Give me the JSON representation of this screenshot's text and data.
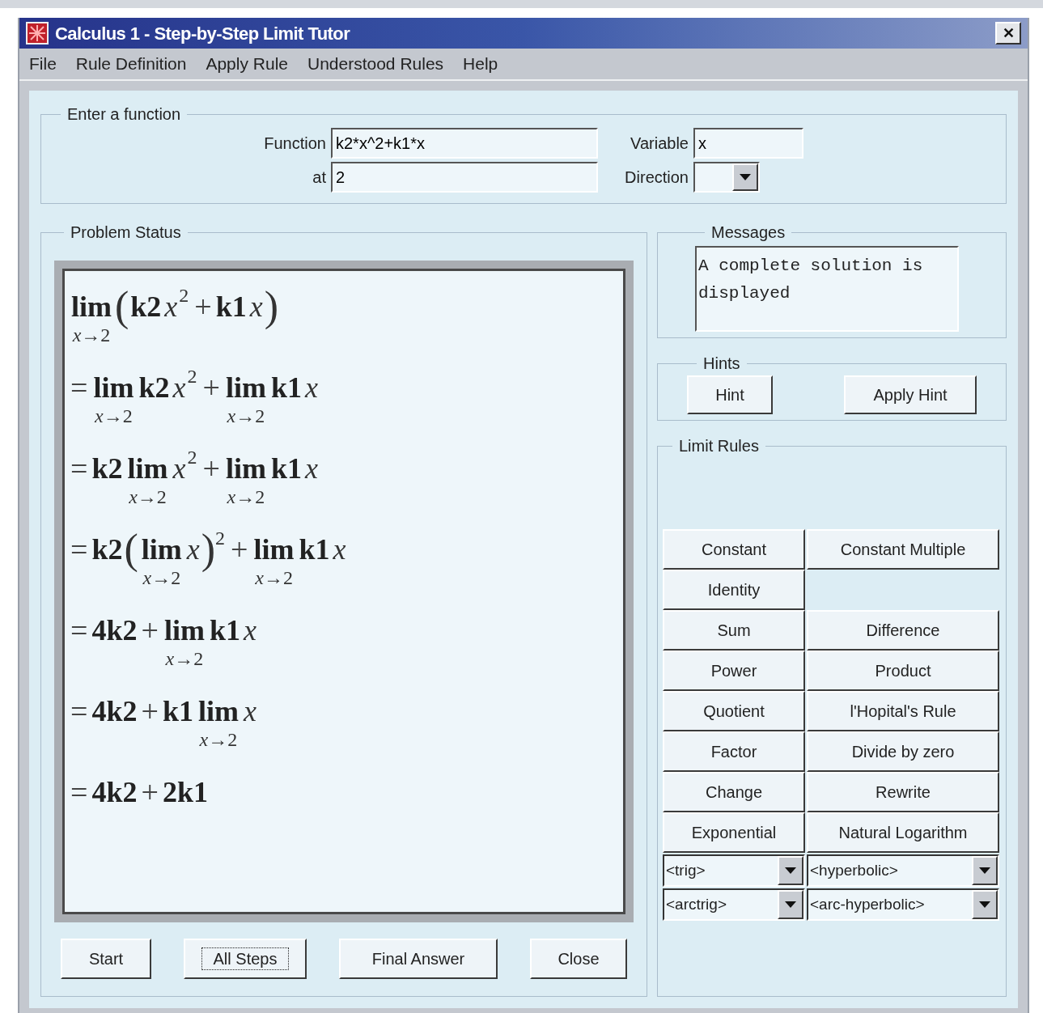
{
  "window": {
    "title": "Calculus 1 - Step-by-Step Limit Tutor",
    "close_glyph": "✕"
  },
  "menu": [
    "File",
    "Rule Definition",
    "Apply Rule",
    "Understood Rules",
    "Help"
  ],
  "input_group": {
    "title": "Enter a function",
    "function_label": "Function",
    "function_value": "k2*x^2+k1*x",
    "variable_label": "Variable",
    "variable_value": "x",
    "at_label": "at",
    "at_value": "2",
    "direction_label": "Direction"
  },
  "problem_status": {
    "title": "Problem Status",
    "steps": [
      [
        {
          "kind": "lim",
          "text": "lim",
          "sub": "*x*→2"
        },
        {
          "kind": "group",
          "open": "(",
          "close": ")",
          "children": [
            {
              "kind": "term",
              "text": "k2"
            },
            {
              "kind": "var",
              "text": "x"
            },
            {
              "kind": "sup",
              "text": "2"
            },
            {
              "kind": "op",
              "text": "+"
            },
            {
              "kind": "term",
              "text": "k1"
            },
            {
              "kind": "var",
              "text": "x"
            }
          ]
        }
      ],
      [
        {
          "kind": "op",
          "text": "="
        },
        {
          "kind": "lim",
          "text": "lim",
          "sub": "*x*→2"
        },
        {
          "kind": "term",
          "text": "k2"
        },
        {
          "kind": "var",
          "text": "x"
        },
        {
          "kind": "sup",
          "text": "2"
        },
        {
          "kind": "op",
          "text": "+"
        },
        {
          "kind": "lim",
          "text": "lim",
          "sub": "*x*→2"
        },
        {
          "kind": "term",
          "text": "k1"
        },
        {
          "kind": "var",
          "text": "x"
        }
      ],
      [
        {
          "kind": "op",
          "text": "="
        },
        {
          "kind": "term",
          "text": "k2"
        },
        {
          "kind": "lim",
          "text": "lim",
          "sub": "*x*→2"
        },
        {
          "kind": "var",
          "text": "x"
        },
        {
          "kind": "sup",
          "text": "2"
        },
        {
          "kind": "op",
          "text": "+"
        },
        {
          "kind": "lim",
          "text": "lim",
          "sub": "*x*→2"
        },
        {
          "kind": "term",
          "text": "k1"
        },
        {
          "kind": "var",
          "text": "x"
        }
      ],
      [
        {
          "kind": "op",
          "text": "="
        },
        {
          "kind": "term",
          "text": "k2"
        },
        {
          "kind": "group",
          "open": "(",
          "close": ")",
          "children": [
            {
              "kind": "lim",
              "text": "lim",
              "sub": "*x*→2"
            },
            {
              "kind": "var",
              "text": "x"
            }
          ]
        },
        {
          "kind": "sup",
          "text": "2"
        },
        {
          "kind": "op",
          "text": "+"
        },
        {
          "kind": "lim",
          "text": "lim",
          "sub": "*x*→2"
        },
        {
          "kind": "term",
          "text": "k1"
        },
        {
          "kind": "var",
          "text": "x"
        }
      ],
      [
        {
          "kind": "op",
          "text": "="
        },
        {
          "kind": "term",
          "text": "4k2"
        },
        {
          "kind": "op",
          "text": "+"
        },
        {
          "kind": "lim",
          "text": "lim",
          "sub": "*x*→2"
        },
        {
          "kind": "term",
          "text": "k1"
        },
        {
          "kind": "var",
          "text": "x"
        }
      ],
      [
        {
          "kind": "op",
          "text": "="
        },
        {
          "kind": "term",
          "text": "4k2"
        },
        {
          "kind": "op",
          "text": "+"
        },
        {
          "kind": "term",
          "text": "k1"
        },
        {
          "kind": "lim",
          "text": "lim",
          "sub": "*x*→2"
        },
        {
          "kind": "var",
          "text": "x"
        }
      ],
      [
        {
          "kind": "op",
          "text": "="
        },
        {
          "kind": "term",
          "text": "4k2"
        },
        {
          "kind": "op",
          "text": "+"
        },
        {
          "kind": "term",
          "text": "2k1"
        }
      ]
    ],
    "buttons": [
      {
        "label": "Start",
        "focused": false
      },
      {
        "label": "All Steps",
        "focused": true
      },
      {
        "label": "Final Answer",
        "focused": false
      },
      {
        "label": "Close",
        "focused": false
      }
    ]
  },
  "messages": {
    "title": "Messages",
    "text": "A complete solution is displayed"
  },
  "hints": {
    "title": "Hints",
    "buttons": [
      "Hint",
      "Apply Hint"
    ]
  },
  "limit_rules": {
    "title": "Limit Rules",
    "rules": [
      {
        "kind": "button",
        "label": "Constant"
      },
      {
        "kind": "button",
        "label": "Constant Multiple"
      },
      {
        "kind": "button",
        "label": "Identity"
      },
      {
        "kind": "empty"
      },
      {
        "kind": "button",
        "label": "Sum"
      },
      {
        "kind": "button",
        "label": "Difference"
      },
      {
        "kind": "button",
        "label": "Power"
      },
      {
        "kind": "button",
        "label": "Product"
      },
      {
        "kind": "button",
        "label": "Quotient"
      },
      {
        "kind": "button",
        "label": "l'Hopital's Rule"
      },
      {
        "kind": "button",
        "label": "Factor"
      },
      {
        "kind": "button",
        "label": "Divide by zero"
      },
      {
        "kind": "button",
        "label": "Change"
      },
      {
        "kind": "button",
        "label": "Rewrite"
      },
      {
        "kind": "button",
        "label": "Exponential"
      },
      {
        "kind": "button",
        "label": "Natural Logarithm"
      },
      {
        "kind": "dropdown",
        "label": "<trig>"
      },
      {
        "kind": "dropdown",
        "label": "<hyperbolic>"
      },
      {
        "kind": "dropdown",
        "label": "<arctrig>"
      },
      {
        "kind": "dropdown",
        "label": "<arc-hyperbolic>"
      }
    ]
  }
}
